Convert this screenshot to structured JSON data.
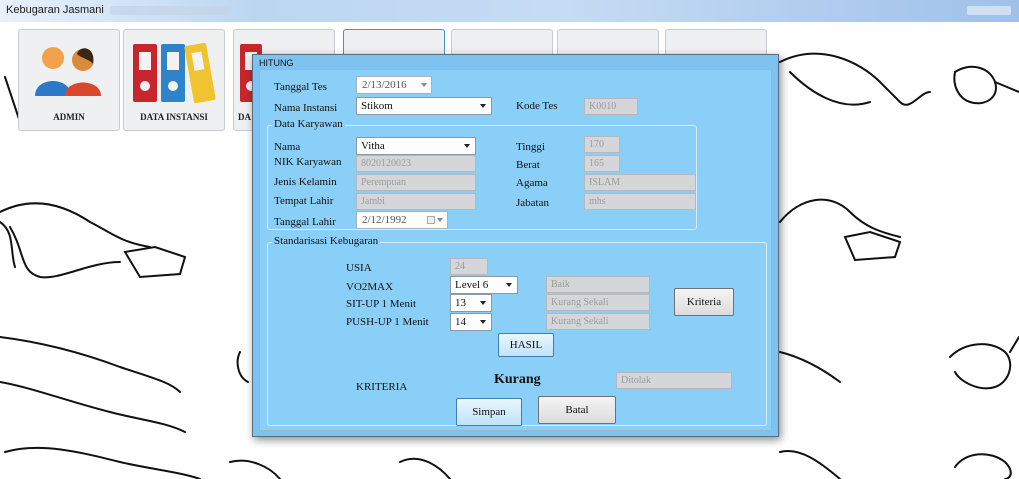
{
  "window": {
    "title": "Kebugaran Jasmani"
  },
  "toolbar": {
    "tiles": [
      {
        "label": "ADMIN",
        "icon": "users-icon"
      },
      {
        "label": "DATA INSTANSI",
        "icon": "binders-icon"
      },
      {
        "label": "DA",
        "icon": "binders-icon"
      }
    ]
  },
  "dialog": {
    "title": "HITUNG",
    "tanggal_tes": {
      "label": "Tanggal Tes",
      "value": "2/13/2016"
    },
    "nama_instansi": {
      "label": "Nama Instansi",
      "value": "Stikom"
    },
    "kode_tes": {
      "label": "Kode Tes",
      "value": "K0010"
    },
    "karyawan": {
      "group_title": "Data Karyawan",
      "nama": {
        "label": "Nama",
        "value": "Vitha"
      },
      "nik": {
        "label": "NIK Karyawan",
        "value": "8020120023"
      },
      "jenis_kelamin": {
        "label": "Jenis Kelamin",
        "value": "Perempuan"
      },
      "tempat_lahir": {
        "label": "Tempat Lahir",
        "value": "Jambi"
      },
      "tanggal_lahir": {
        "label": "Tanggal Lahir",
        "value": "2/12/1992"
      },
      "tinggi": {
        "label": "Tinggi",
        "value": "170"
      },
      "berat": {
        "label": "Berat",
        "value": "165"
      },
      "agama": {
        "label": "Agama",
        "value": "ISLAM"
      },
      "jabatan": {
        "label": "Jabatan",
        "value": "mhs"
      }
    },
    "standar": {
      "group_title": "Standarisasi Kebugaran",
      "usia": {
        "label": "USIA",
        "value": "24"
      },
      "vo2max": {
        "label": "VO2MAX",
        "value": "Level 6",
        "result": "Baik"
      },
      "situp": {
        "label": "SIT-UP 1 Menit",
        "value": "13",
        "result": "Kurang Sekali"
      },
      "pushup": {
        "label": "PUSH-UP 1 Menit",
        "value": "14",
        "result": "Kurang Sekali"
      },
      "kriteria_button": "Kriteria",
      "hasil_button": "HASIL",
      "kriteria_label": "KRITERIA",
      "kriteria_value": "Kurang",
      "status": "Ditolak"
    },
    "simpan_button": "Simpan",
    "batal_button": "Batal"
  }
}
